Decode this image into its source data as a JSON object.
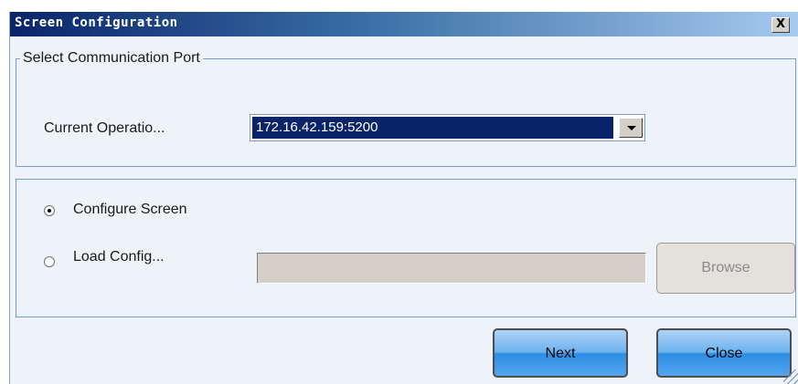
{
  "window": {
    "title": "Screen Configuration",
    "close_glyph": "X"
  },
  "port_group": {
    "legend": "Select Communication Port",
    "label": "Current Operatio...",
    "selected_value": "172.16.42.159:5200"
  },
  "options": {
    "configure_label": "Configure Screen",
    "configure_checked": true,
    "load_label": "Load Config...",
    "load_checked": false,
    "load_path": "",
    "browse_label": "Browse"
  },
  "footer": {
    "next_label": "Next",
    "close_label": "Close"
  },
  "colors": {
    "title_gradient_start": "#0a246a",
    "title_gradient_end": "#a6caf0",
    "selection_bg": "#0a246a",
    "button_blue": "#2c8de4"
  },
  "icons": {
    "close": "close-icon",
    "dropdown": "chevron-down-icon",
    "resize": "resize-grip-icon"
  }
}
